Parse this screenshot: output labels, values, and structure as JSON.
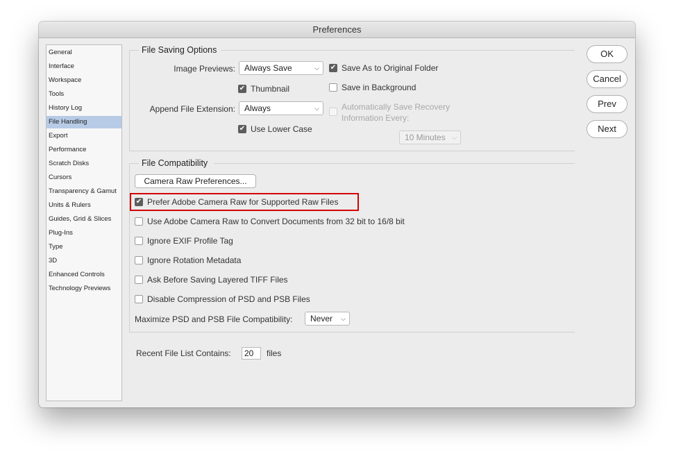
{
  "window": {
    "title": "Preferences"
  },
  "sidebar": {
    "items": [
      {
        "label": "General",
        "selected": false
      },
      {
        "label": "Interface",
        "selected": false
      },
      {
        "label": "Workspace",
        "selected": false
      },
      {
        "label": "Tools",
        "selected": false
      },
      {
        "label": "History Log",
        "selected": false
      },
      {
        "label": "File Handling",
        "selected": true
      },
      {
        "label": "Export",
        "selected": false
      },
      {
        "label": "Performance",
        "selected": false
      },
      {
        "label": "Scratch Disks",
        "selected": false
      },
      {
        "label": "Cursors",
        "selected": false
      },
      {
        "label": "Transparency & Gamut",
        "selected": false
      },
      {
        "label": "Units & Rulers",
        "selected": false
      },
      {
        "label": "Guides, Grid & Slices",
        "selected": false
      },
      {
        "label": "Plug-Ins",
        "selected": false
      },
      {
        "label": "Type",
        "selected": false
      },
      {
        "label": "3D",
        "selected": false
      },
      {
        "label": "Enhanced Controls",
        "selected": false
      },
      {
        "label": "Technology Previews",
        "selected": false
      }
    ]
  },
  "file_saving": {
    "title": "File Saving Options",
    "image_previews_label": "Image Previews:",
    "image_previews_value": "Always Save",
    "thumbnail_label": "Thumbnail",
    "thumbnail_checked": true,
    "append_ext_label": "Append File Extension:",
    "append_ext_value": "Always",
    "lower_case_label": "Use Lower Case",
    "lower_case_checked": true,
    "save_as_original_label": "Save As to Original Folder",
    "save_as_original_checked": true,
    "save_background_label": "Save in Background",
    "save_background_checked": false,
    "auto_save_label_line1": "Automatically Save Recovery",
    "auto_save_label_line2": "Information Every:",
    "auto_save_checked": false,
    "auto_save_interval": "10 Minutes"
  },
  "compat": {
    "title": "File Compatibility",
    "camera_raw_button": "Camera Raw Preferences...",
    "options": [
      {
        "label": "Prefer Adobe Camera Raw for Supported Raw Files",
        "checked": true
      },
      {
        "label": "Use Adobe Camera Raw to Convert Documents from 32 bit to 16/8 bit",
        "checked": false
      },
      {
        "label": "Ignore EXIF Profile Tag",
        "checked": false
      },
      {
        "label": "Ignore Rotation Metadata",
        "checked": false
      },
      {
        "label": "Ask Before Saving Layered TIFF Files",
        "checked": false
      },
      {
        "label": "Disable Compression of PSD and PSB Files",
        "checked": false
      }
    ],
    "maximize_label": "Maximize PSD and PSB File Compatibility:",
    "maximize_value": "Never"
  },
  "recent": {
    "label": "Recent File List Contains:",
    "value": "20",
    "suffix": "files"
  },
  "buttons": {
    "ok": "OK",
    "cancel": "Cancel",
    "prev": "Prev",
    "next": "Next"
  },
  "icons": {
    "check": "✔",
    "chevron": "⌵"
  }
}
